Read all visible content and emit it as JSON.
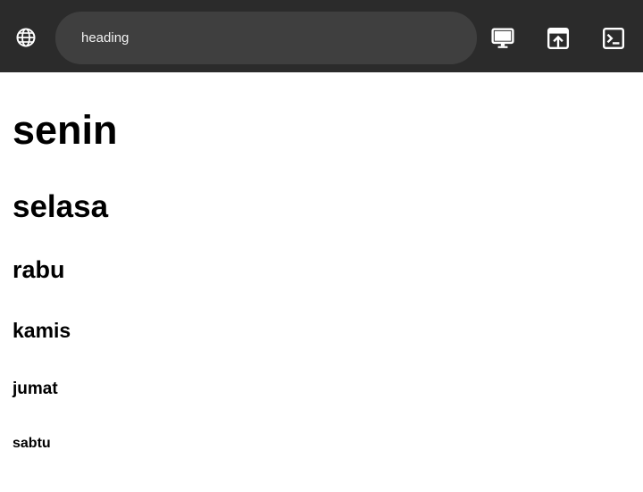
{
  "toolbar": {
    "url_text": "heading",
    "icons": {
      "site": "globe-icon",
      "desktop": "desktop-icon",
      "open": "open-in-new-icon",
      "terminal": "terminal-icon"
    },
    "colors": {
      "background": "#2b2b2b",
      "urlbar": "#3f3f3f",
      "icon": "#ffffff"
    }
  },
  "page": {
    "headings": [
      {
        "level": 1,
        "text": "senin"
      },
      {
        "level": 2,
        "text": "selasa"
      },
      {
        "level": 3,
        "text": "rabu"
      },
      {
        "level": 4,
        "text": "kamis"
      },
      {
        "level": 5,
        "text": "jumat"
      },
      {
        "level": 6,
        "text": "sabtu"
      }
    ]
  }
}
